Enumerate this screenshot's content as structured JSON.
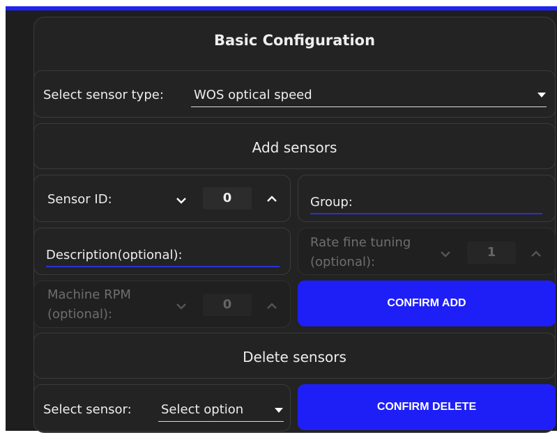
{
  "basic": {
    "title": "Basic Configuration"
  },
  "sensor_type": {
    "label": "Select sensor type:",
    "value": "WOS optical speed"
  },
  "add": {
    "title": "Add sensors",
    "sensor_id_label": "Sensor ID:",
    "sensor_id_value": "0",
    "group_label": "Group:",
    "description_label": "Description(optional):",
    "rate_label_line1": "Rate fine tuning",
    "rate_label_line2": "(optional):",
    "rate_value": "1",
    "rpm_label_line1": "Machine RPM",
    "rpm_label_line2": "(optional):",
    "rpm_value": "0",
    "confirm_label": "CONFIRM ADD"
  },
  "delete": {
    "title": "Delete sensors",
    "select_label": "Select sensor:",
    "select_value": "Select option",
    "confirm_label": "CONFIRM DELETE"
  },
  "colors": {
    "accent": "#1e1ff6",
    "background": "#1e1e1e",
    "panel": "#232323"
  }
}
